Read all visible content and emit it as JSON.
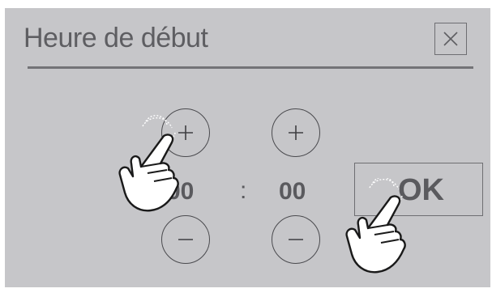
{
  "dialog": {
    "title": "Heure de début",
    "close_icon": "close-icon"
  },
  "time": {
    "hours": "00",
    "separator": ":",
    "minutes": "00"
  },
  "buttons": {
    "increment_icon": "plus-icon",
    "decrement_icon": "minus-icon",
    "confirm_label": "OK"
  },
  "colors": {
    "panel": "#c6c6c9",
    "text": "#5a5a5e",
    "line": "#737377"
  }
}
